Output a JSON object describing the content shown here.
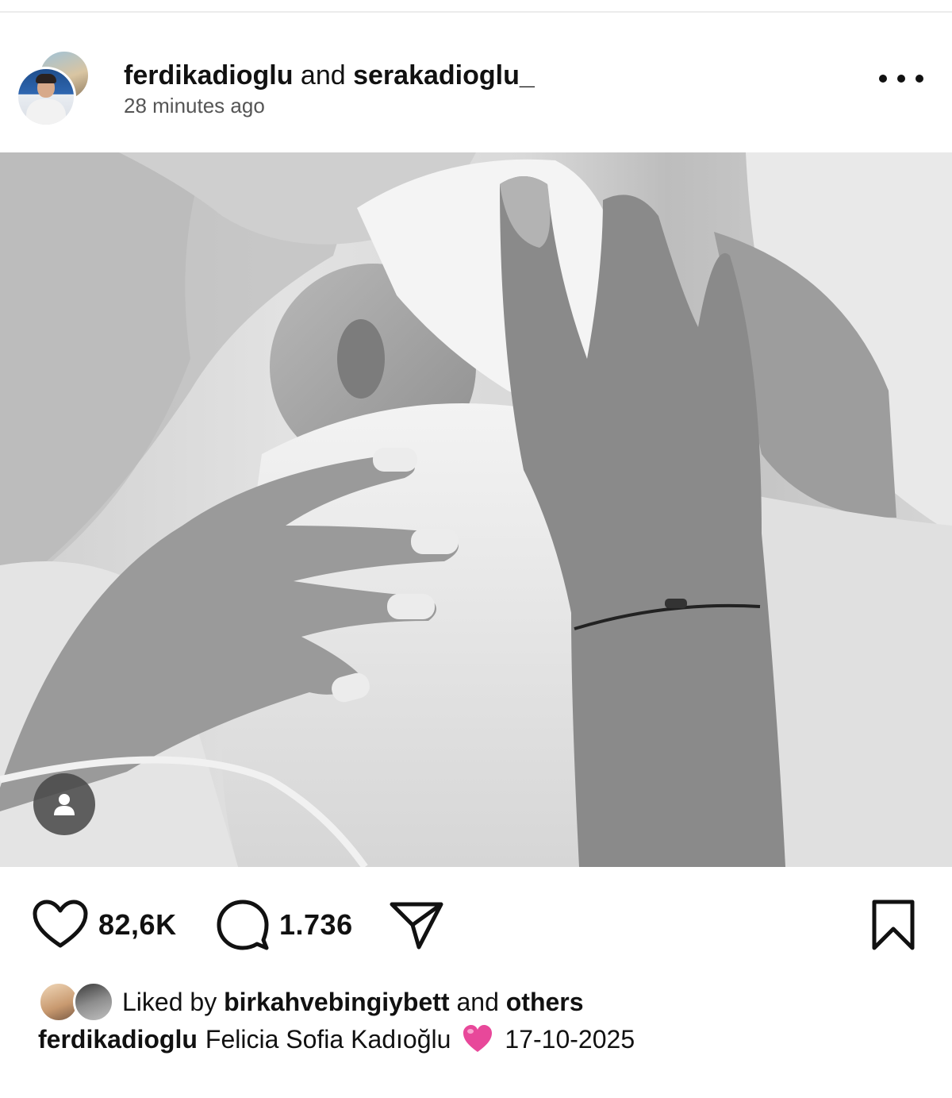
{
  "header": {
    "username_1": "ferdikadioglu",
    "and_label": "and",
    "username_2": "serakadioglu_",
    "time": "28 minutes ago",
    "more_icon": "more-horizontal-icon"
  },
  "post": {
    "photo_desc_icon": "tag-people-icon"
  },
  "actions": {
    "likes_count": "82,6K",
    "comments_count": "1.736",
    "icons": [
      "heart-icon",
      "comment-icon",
      "share-icon",
      "bookmark-icon"
    ]
  },
  "liked_by": {
    "prefix": "Liked by",
    "user": "birkahvebingiybett",
    "conj": "and",
    "others": "others"
  },
  "caption": {
    "username": "ferdikadioglu",
    "text": "Felicia Sofia Kadıoğlu",
    "date": "17-10-2025",
    "emoji_color": "#e8489a"
  }
}
